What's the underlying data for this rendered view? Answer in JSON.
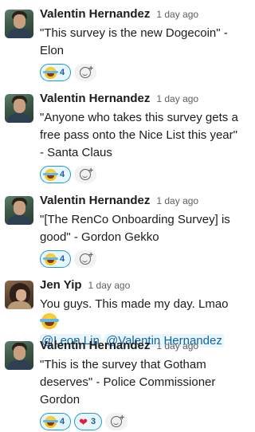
{
  "messages": [
    {
      "author": "Valentin Hernandez",
      "time": "1 day ago",
      "text": "\"This survey is the new Dogecoin\" - Elon",
      "reactions": [
        {
          "emoji": "joy",
          "count": "4"
        }
      ]
    },
    {
      "author": "Valentin Hernandez",
      "time": "1 day ago",
      "text": "\"Anyone who takes this survey gets a free pass onto the Nice List this year\" - Santa Claus",
      "reactions": [
        {
          "emoji": "joy",
          "count": "4"
        }
      ]
    },
    {
      "author": "Valentin Hernandez",
      "time": "1 day ago",
      "text": "\"[The RenCo Onboarding Survey] is good\" - Gordon Gekko",
      "reactions": [
        {
          "emoji": "joy",
          "count": "4"
        }
      ]
    },
    {
      "author": "Jen Yip",
      "time": "1 day ago",
      "text": "You guys. This made my day. Lmao",
      "mentions": [
        "@Leon Lin",
        "@Valentin Hernandez"
      ]
    },
    {
      "author": "Valentin Hernandez",
      "time": "1 day ago",
      "text": "\"This is the survey that Gotham deserves\" - Police Commissioner Gordon",
      "reactions": [
        {
          "emoji": "joy",
          "count": "4"
        },
        {
          "emoji": "heart",
          "count": "3"
        }
      ]
    }
  ],
  "icons": {
    "add_reaction": "add-reaction-icon",
    "joy": "face-with-tears-of-joy-icon",
    "heart": "red-heart-icon"
  },
  "colors": {
    "reaction_border": "#1d9bd1",
    "reaction_bg": "#e8f5fa",
    "mention_text": "#1264a3",
    "heart": "#e01e3a"
  }
}
